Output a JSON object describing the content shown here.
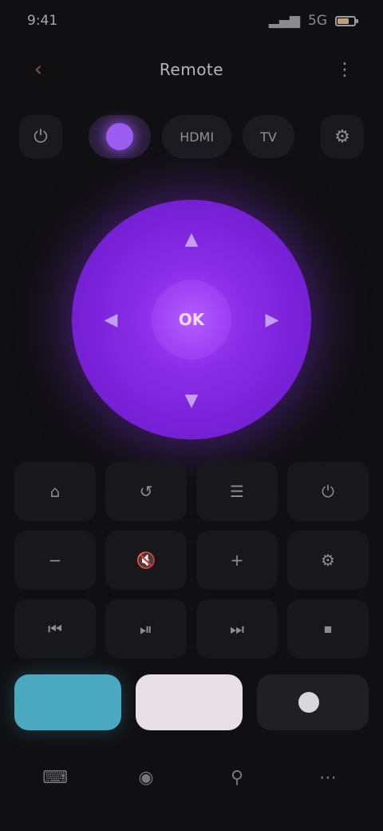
{
  "status": {
    "time": "9:41",
    "carrier": "5G",
    "signal": "▂▄▆"
  },
  "header": {
    "title": "Remote",
    "back_icon": "back-icon",
    "menu_icon": "more-icon"
  },
  "sources": {
    "left_icon": "power-icon",
    "pills": [
      {
        "label": "",
        "active": true
      },
      {
        "label": "HDMI",
        "active": false
      },
      {
        "label": "TV",
        "active": false
      }
    ],
    "right_icon": "settings-icon"
  },
  "dpad": {
    "up": "▲",
    "down": "▼",
    "left": "◀",
    "right": "▶",
    "ok": "OK",
    "accent": "#8a2ee8"
  },
  "keys": [
    {
      "label": "⌂",
      "name": "home-icon"
    },
    {
      "label": "↺",
      "name": "back-arrow-icon"
    },
    {
      "label": "☰",
      "name": "menu-icon"
    },
    {
      "label": "⏻",
      "name": "power-icon"
    },
    {
      "label": "−",
      "name": "volume-down-icon"
    },
    {
      "label": "🔇",
      "name": "mute-icon"
    },
    {
      "label": "+",
      "name": "volume-up-icon"
    },
    {
      "label": "⚙",
      "name": "settings-icon"
    },
    {
      "label": "⏮",
      "name": "previous-icon"
    },
    {
      "label": "⏯",
      "name": "play-pause-icon"
    },
    {
      "label": "⏭",
      "name": "next-icon"
    },
    {
      "label": "⏹",
      "name": "stop-icon"
    }
  ],
  "big_buttons": {
    "teal": "",
    "light": "",
    "ghost": ""
  },
  "bottom": [
    {
      "label": "⌨",
      "name": "keyboard-icon"
    },
    {
      "label": "◉",
      "name": "touchpad-icon"
    },
    {
      "label": "⚲",
      "name": "search-icon"
    },
    {
      "label": "⋯",
      "name": "more-icon"
    }
  ]
}
